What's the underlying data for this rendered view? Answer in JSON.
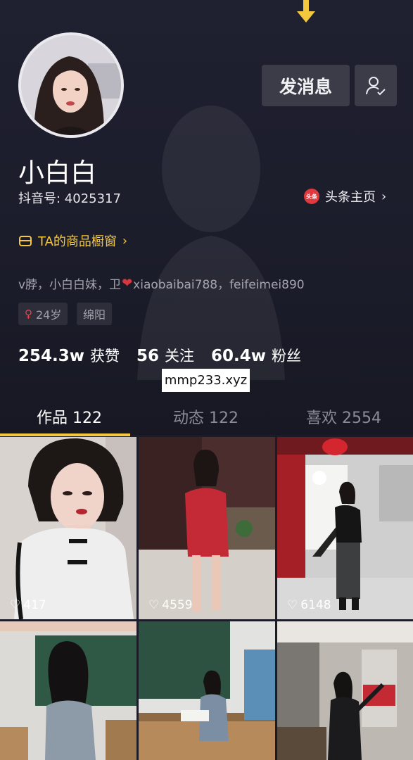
{
  "profile": {
    "name": "小白白",
    "douyin_id": "抖音号: 4025317",
    "toutiao_badge": "头条",
    "toutiao_label": "头条主页",
    "shop_label": "TA的商品橱窗",
    "bio_before_heart": "v脖，小白白妹，卫",
    "bio_after_heart": "xiaobaibai788，feifeimei890",
    "tags": [
      "24岁",
      "绵阳"
    ]
  },
  "buttons": {
    "message": "发消息",
    "follow_icon": "user-check-icon"
  },
  "stats": [
    {
      "value": "254.3w",
      "label": "获赞"
    },
    {
      "value": "56",
      "label": "关注"
    },
    {
      "value": "60.4w",
      "label": "粉丝"
    }
  ],
  "watermark": "mmp233.xyz",
  "tabs": [
    {
      "label": "作品 122",
      "active": true
    },
    {
      "label": "动态 122",
      "active": false
    },
    {
      "label": "喜欢 2554",
      "active": false
    }
  ],
  "videos": [
    {
      "likes": "417"
    },
    {
      "likes": "4559"
    },
    {
      "likes": "6148"
    },
    {
      "likes": ""
    },
    {
      "likes": ""
    },
    {
      "likes": ""
    }
  ],
  "colors": {
    "accent": "#f5c73e",
    "background": "#161823",
    "button": "#3b3c48",
    "heart": "#d9363e"
  }
}
